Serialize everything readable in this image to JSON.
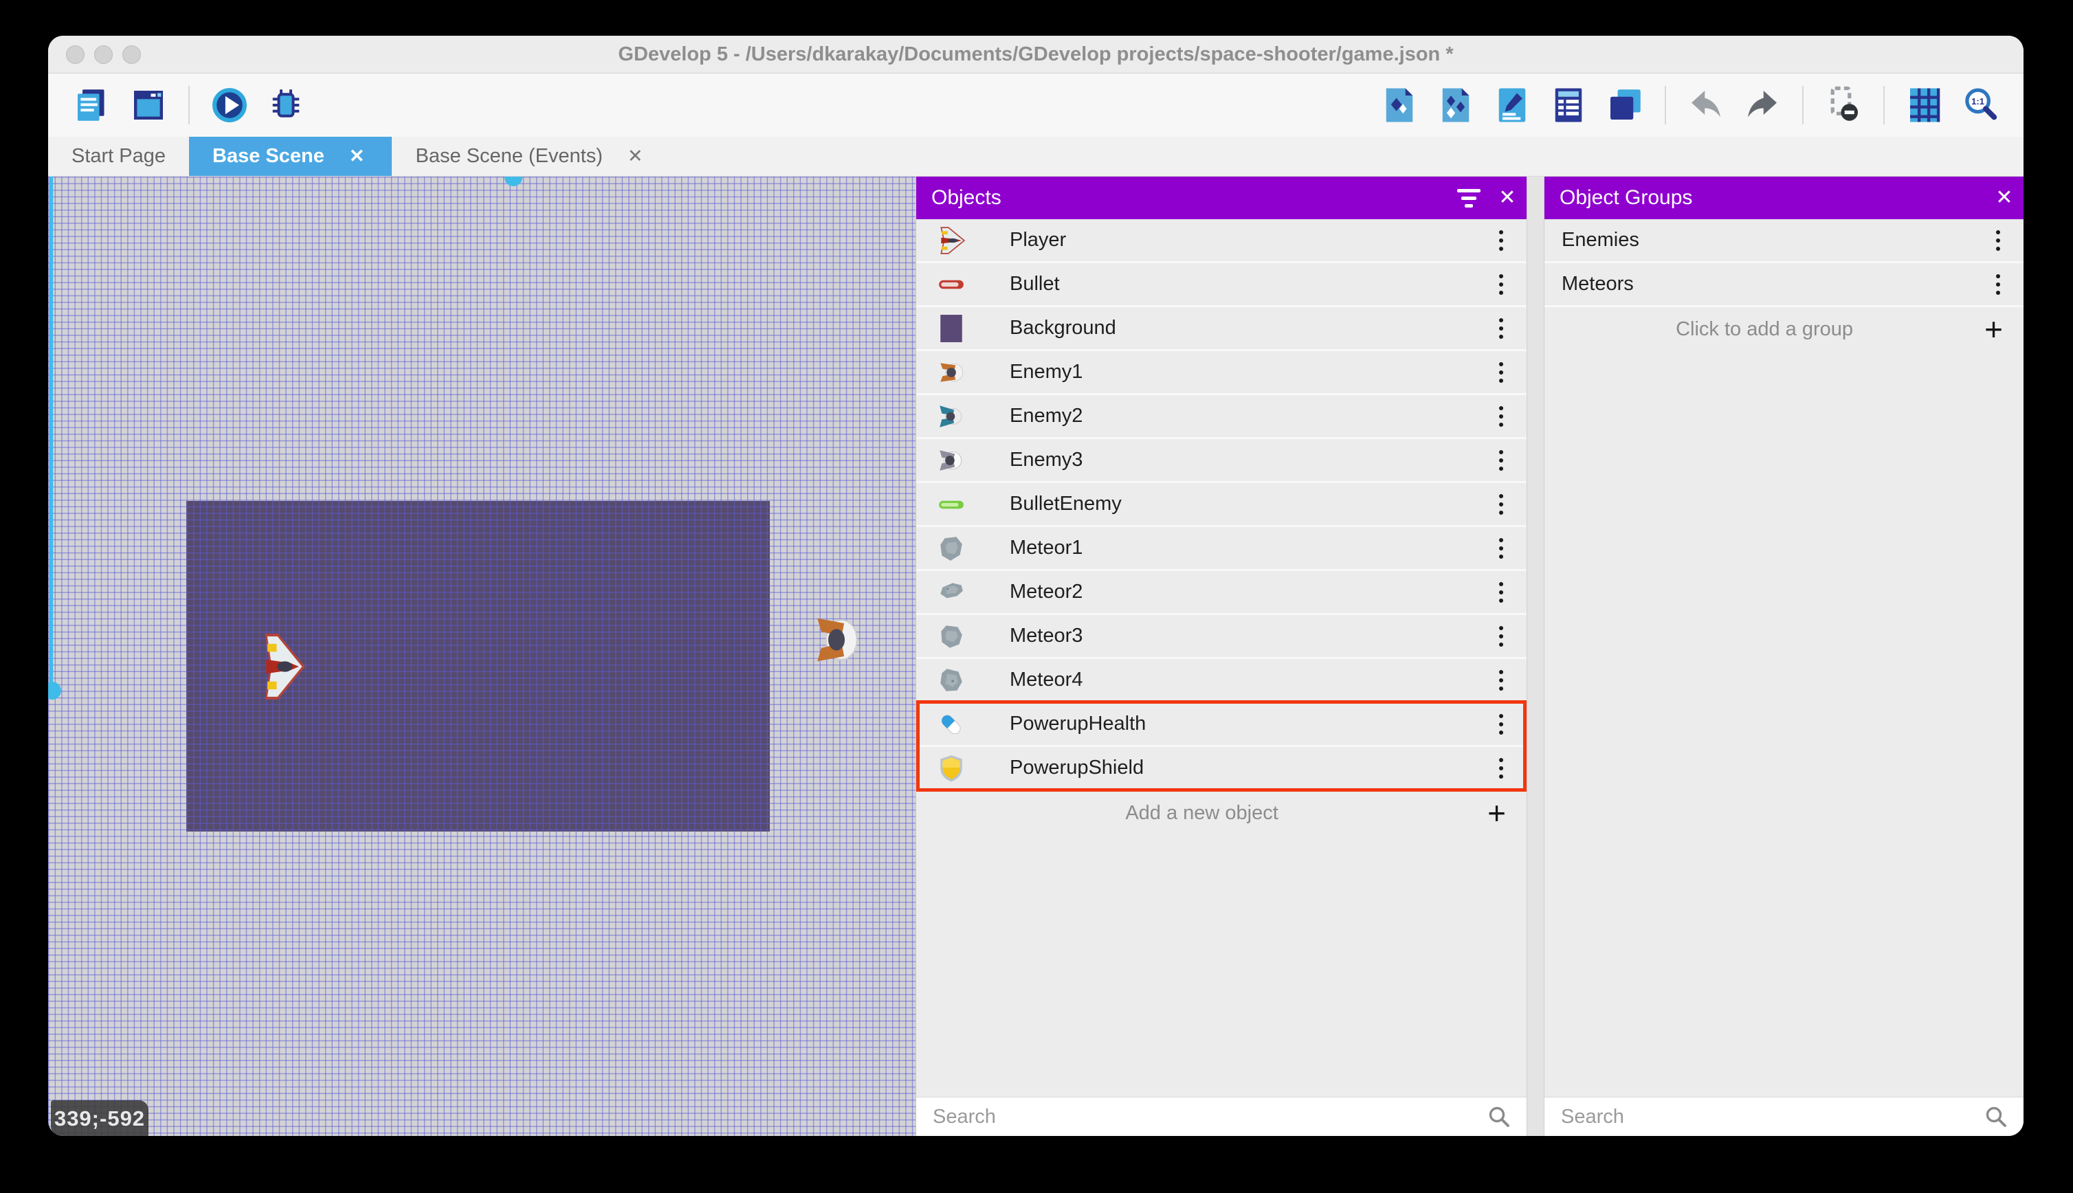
{
  "window": {
    "title": "GDevelop 5 - /Users/dkarakay/Documents/GDevelop projects/space-shooter/game.json *"
  },
  "colors": {
    "panel_header_purple": "#8F00CE",
    "active_tab_blue": "#4BA7E3",
    "highlight_red": "#F2360F"
  },
  "toolbar": {
    "left_groups": [
      [
        "project-manager-icon",
        "scene-editor-icon"
      ],
      [
        "play-icon",
        "debug-icon"
      ]
    ],
    "right_groups": [
      [
        "object-icon",
        "objects-list-icon",
        "edit-scene-properties-icon",
        "instances-list-icon",
        "layers-icon"
      ],
      [
        "undo-icon",
        "redo-icon"
      ],
      [
        "window-mask-icon"
      ],
      [
        "grid-icon",
        "zoom-1-1-icon"
      ]
    ]
  },
  "tabs": [
    {
      "label": "Start Page",
      "active": false,
      "closable": false
    },
    {
      "label": "Base Scene",
      "active": true,
      "closable": true,
      "close_glyph": "✕"
    },
    {
      "label": "Base Scene (Events)",
      "active": false,
      "closable": true,
      "close_glyph": "✕"
    }
  ],
  "canvas": {
    "coordinates": "339;-592"
  },
  "objects_panel": {
    "title": "Objects",
    "items": [
      {
        "label": "Player",
        "icon": "player"
      },
      {
        "label": "Bullet",
        "icon": "bullet"
      },
      {
        "label": "Background",
        "icon": "background"
      },
      {
        "label": "Enemy1",
        "icon": "enemy1"
      },
      {
        "label": "Enemy2",
        "icon": "enemy2"
      },
      {
        "label": "Enemy3",
        "icon": "enemy3"
      },
      {
        "label": "BulletEnemy",
        "icon": "bullet-enemy"
      },
      {
        "label": "Meteor1",
        "icon": "meteor-a"
      },
      {
        "label": "Meteor2",
        "icon": "meteor-b"
      },
      {
        "label": "Meteor3",
        "icon": "meteor-c"
      },
      {
        "label": "Meteor4",
        "icon": "meteor-d"
      },
      {
        "label": "PowerupHealth",
        "icon": "powerup-health",
        "highlighted": true
      },
      {
        "label": "PowerupShield",
        "icon": "powerup-shield",
        "highlighted": true
      }
    ],
    "add_label": "Add a new object",
    "search_placeholder": "Search"
  },
  "groups_panel": {
    "title": "Object Groups",
    "items": [
      {
        "label": "Enemies"
      },
      {
        "label": "Meteors"
      }
    ],
    "add_label": "Click to add a group",
    "search_placeholder": "Search"
  }
}
